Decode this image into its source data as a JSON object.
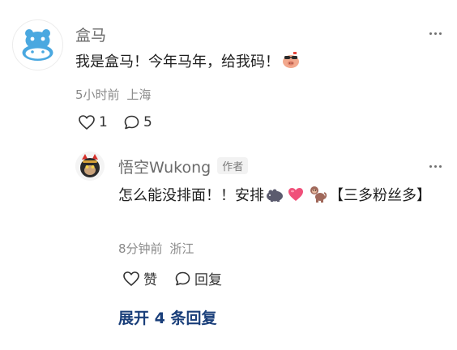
{
  "comment": {
    "author": "盒马",
    "text_before": "我是盒马！今年马年，给我码！",
    "time": "5小时前",
    "location": "上海",
    "like_count": "1",
    "reply_count": "5",
    "avatar_icon": "hippo-avatar-icon",
    "emoji_icon": "pig-sunglasses-emoji"
  },
  "reply": {
    "author": "悟空Wukong",
    "author_badge": "作者",
    "text_part1": "怎么能没排面！！安排",
    "text_part2": "【三多粉丝多】",
    "time": "8分钟前",
    "location": "浙江",
    "like_label": "赞",
    "reply_label": "回复",
    "avatar_icon": "wukong-avatar-icon",
    "emoji_icons": [
      "hippo-emoji",
      "heart-emoji",
      "monkey-emoji"
    ]
  },
  "expand": {
    "label": "展开 4 条回复"
  },
  "colors": {
    "link": "#1a3f7a",
    "meta": "#8a8a8a",
    "hippo_blue": "#4aa8e0",
    "heart_pink": "#f0507a"
  }
}
